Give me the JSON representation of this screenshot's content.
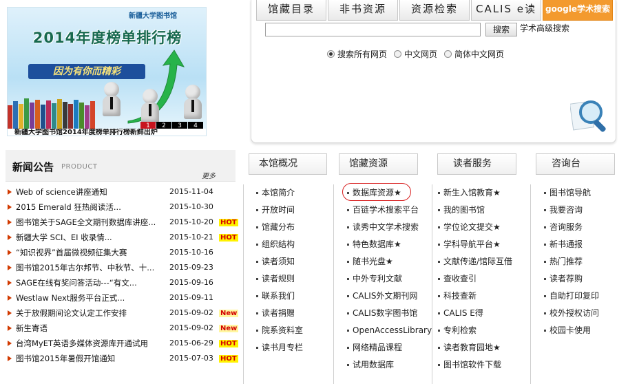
{
  "banner": {
    "org": "新疆大学图书馆",
    "headline": "2014年度榜单排行榜",
    "slogan": "因为有你而精彩",
    "caption": "新疆大学图书馆2014年度榜单排行榜新鲜出炉",
    "pager": [
      "1",
      "2",
      "3",
      "4"
    ],
    "active_page": "1"
  },
  "search": {
    "tabs": [
      "馆藏目录",
      "非书资源",
      "资源检索",
      "CALIS e读",
      "google学术搜索"
    ],
    "query": "",
    "button": "搜索",
    "advanced_link": "学术高级搜索",
    "options": [
      {
        "label": "搜索所有网页",
        "checked": true
      },
      {
        "label": "中文网页",
        "checked": false
      },
      {
        "label": "简体中文网页",
        "checked": false
      }
    ]
  },
  "news": {
    "title": "新闻公告",
    "subtitle": "PRODUCT",
    "more": "更多",
    "items": [
      {
        "title": "Web of science讲座通知",
        "date": "2015-11-04",
        "badge": ""
      },
      {
        "title": "2015 Emerald 狂热阅读活...",
        "date": "2015-10-30",
        "badge": ""
      },
      {
        "title": "图书馆关于SAGE全文期刊数据库讲座...",
        "date": "2015-10-20",
        "badge": "HOT"
      },
      {
        "title": "新疆大学 SCI、EI 收录情...",
        "date": "2015-10-21",
        "badge": "HOT"
      },
      {
        "title": "“知识视界”首届微视频征集大赛",
        "date": "2015-10-16",
        "badge": ""
      },
      {
        "title": "图书馆2015年古尔邦节、中秋节、十...",
        "date": "2015-09-23",
        "badge": ""
      },
      {
        "title": "SAGE在线有奖问答活动---“有文...",
        "date": "2015-09-16",
        "badge": ""
      },
      {
        "title": "Westlaw Next服务平台正式...",
        "date": "2015-09-11",
        "badge": ""
      },
      {
        "title": "关于放假期间论文认定工作安排",
        "date": "2015-09-02",
        "badge": "New"
      },
      {
        "title": "新生寄语",
        "date": "2015-09-02",
        "badge": "New"
      },
      {
        "title": "台湾MyET英语多媒体资源库开通试用",
        "date": "2015-06-29",
        "badge": "HOT"
      },
      {
        "title": "图书馆2015年暑假开馆通知",
        "date": "2015-07-03",
        "badge": "HOT"
      }
    ]
  },
  "columns": [
    {
      "header": "本馆概况",
      "items": [
        "本馆简介",
        "开放时间",
        "馆藏分布",
        "组织结构",
        "读者须知",
        "读者规则",
        "联系我们",
        "读者捐赠",
        "院系资料室",
        "读书月专栏"
      ]
    },
    {
      "header": "馆藏资源",
      "items": [
        "数据库资源★",
        "百链学术搜索平台",
        "读秀中文学术搜索",
        "特色数据库★",
        "随书光盘★",
        "中外专利文献",
        "CALIS外文期刊网",
        "CALIS数字图书馆",
        "OpenAccessLibrary",
        "网络精品课程",
        "试用数据库"
      ]
    },
    {
      "header": "读者服务",
      "items": [
        "新生入馆教育★",
        "我的图书馆",
        "学位论文提交★",
        "学科导航平台★",
        "文献传递/馆际互借",
        "查收查引",
        "科技查新",
        "CALIS E得",
        "专利检索",
        "读者教育园地★",
        "图书馆软件下载"
      ]
    },
    {
      "header": "咨询台",
      "items": [
        "图书馆导航",
        "我要咨询",
        "咨询服务",
        "新书通报",
        "热门推荐",
        "读者荐购",
        "自助打印复印",
        "校外授权访问",
        "校园卡使用"
      ]
    }
  ],
  "colors": {
    "accent": "#f39a2e",
    "hot_bg": "#fff200",
    "badge_text": "#d40000",
    "arrow": "#d23a00",
    "highlight": "#d82020"
  }
}
